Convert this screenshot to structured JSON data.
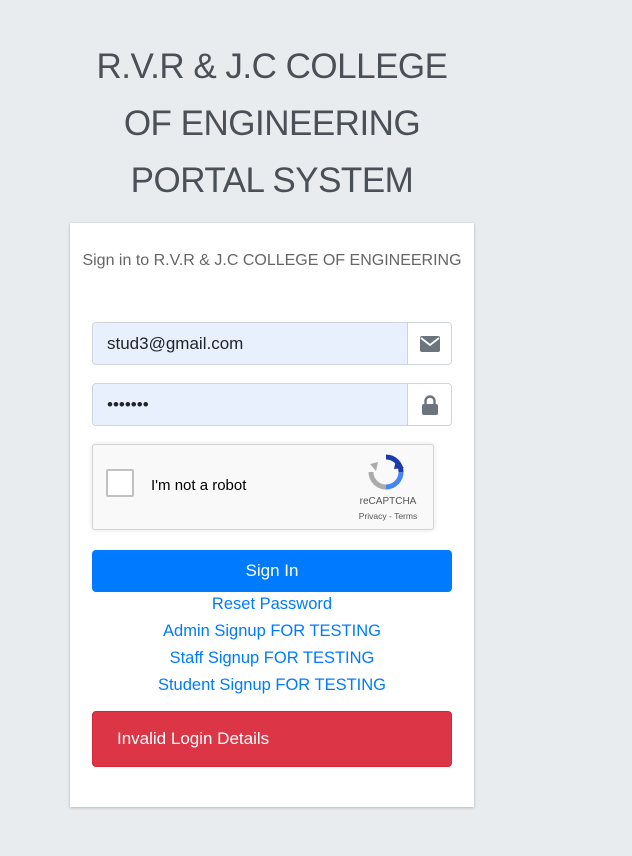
{
  "header": {
    "title_bold": "R.V.R & J.C COLLEGE OF ENGINEERING",
    "title_light": "PORTAL SYSTEM"
  },
  "login_box": {
    "message": "Sign in to R.V.R & J.C COLLEGE OF ENGINEERING",
    "email": {
      "value": "stud3@gmail.com",
      "icon": "envelope-icon"
    },
    "password": {
      "value": "•••••••",
      "icon": "lock-icon"
    },
    "recaptcha": {
      "label": "I'm not a robot",
      "brand": "reCAPTCHA",
      "privacy": "Privacy",
      "separator": " - ",
      "terms": "Terms"
    },
    "sign_in_label": "Sign In",
    "links": {
      "reset_password": "Reset Password",
      "admin_signup": "Admin Signup FOR TESTING",
      "staff_signup": "Staff Signup FOR TESTING",
      "student_signup": "Student Signup FOR TESTING"
    },
    "alert": "Invalid Login Details"
  },
  "colors": {
    "background": "#e9ecef",
    "primary": "#007bff",
    "danger": "#dc3545",
    "input_fill": "#e8f0fe"
  }
}
